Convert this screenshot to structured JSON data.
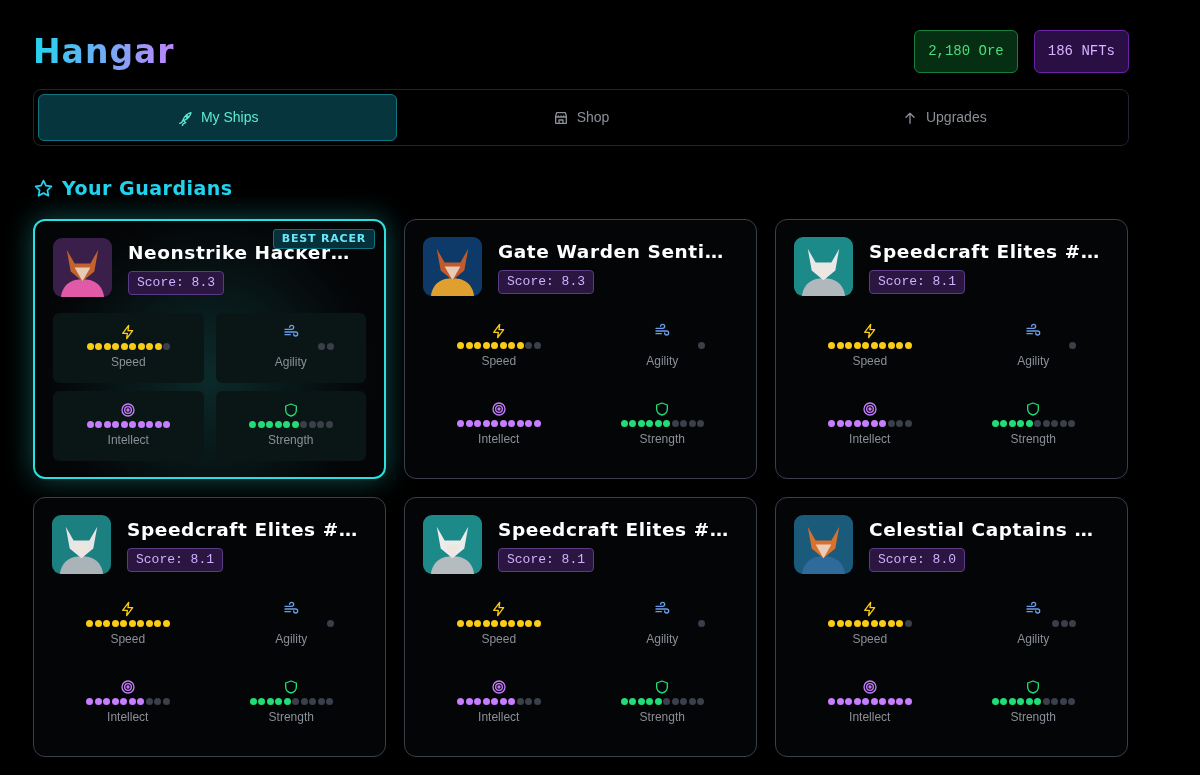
{
  "header": {
    "title": "Hangar",
    "balances": [
      {
        "kind": "ore",
        "text": "2,180 Ore"
      },
      {
        "kind": "nft",
        "text": "186 NFTs"
      }
    ]
  },
  "tabs": [
    {
      "kind": "rocket",
      "label": "My Ships",
      "selected": true
    },
    {
      "kind": "shop",
      "label": "Shop",
      "selected": false
    },
    {
      "kind": "upgrade",
      "label": "Upgrades",
      "selected": false
    }
  ],
  "section": {
    "title": "Your Guardians"
  },
  "cards": [
    {
      "name": "Neonstrike Hacker…",
      "score": "Score: 8.3",
      "badge": "BEST RACER",
      "highlighted": true,
      "stats": [
        {
          "kind": "speed",
          "label": "Speed",
          "dots": [
            true,
            true,
            true,
            true,
            true,
            true,
            true,
            true,
            true,
            false
          ]
        },
        {
          "kind": "agility",
          "label": "Agility",
          "dots": [
            false,
            false
          ]
        },
        {
          "kind": "intellect",
          "label": "Intellect",
          "dots": [
            true,
            true,
            true,
            true,
            true,
            true,
            true,
            true,
            true,
            true
          ]
        },
        {
          "kind": "strength",
          "label": "Strength",
          "dots": [
            true,
            true,
            true,
            true,
            true,
            true,
            false,
            false,
            false,
            false
          ]
        }
      ]
    },
    {
      "name": "Gate Warden Senti…",
      "score": "Score: 8.3",
      "highlighted": false,
      "stats": [
        {
          "kind": "speed",
          "label": "Speed",
          "dots": [
            true,
            true,
            true,
            true,
            true,
            true,
            true,
            true,
            false,
            false
          ]
        },
        {
          "kind": "agility",
          "label": "Agility",
          "dots": [
            false
          ]
        },
        {
          "kind": "intellect",
          "label": "Intellect",
          "dots": [
            true,
            true,
            true,
            true,
            true,
            true,
            true,
            true,
            true,
            true
          ]
        },
        {
          "kind": "strength",
          "label": "Strength",
          "dots": [
            true,
            true,
            true,
            true,
            true,
            true,
            false,
            false,
            false,
            false
          ]
        }
      ]
    },
    {
      "name": "Speedcraft Elites #…",
      "score": "Score: 8.1",
      "highlighted": false,
      "stats": [
        {
          "kind": "speed",
          "label": "Speed",
          "dots": [
            true,
            true,
            true,
            true,
            true,
            true,
            true,
            true,
            true,
            true
          ]
        },
        {
          "kind": "agility",
          "label": "Agility",
          "dots": [
            false
          ]
        },
        {
          "kind": "intellect",
          "label": "Intellect",
          "dots": [
            true,
            true,
            true,
            true,
            true,
            true,
            true,
            false,
            false,
            false
          ]
        },
        {
          "kind": "strength",
          "label": "Strength",
          "dots": [
            true,
            true,
            true,
            true,
            true,
            false,
            false,
            false,
            false,
            false
          ]
        }
      ]
    },
    {
      "name": "Speedcraft Elites #…",
      "score": "Score: 8.1",
      "highlighted": false,
      "stats": [
        {
          "kind": "speed",
          "label": "Speed",
          "dots": [
            true,
            true,
            true,
            true,
            true,
            true,
            true,
            true,
            true,
            true
          ]
        },
        {
          "kind": "agility",
          "label": "Agility",
          "dots": [
            false
          ]
        },
        {
          "kind": "intellect",
          "label": "Intellect",
          "dots": [
            true,
            true,
            true,
            true,
            true,
            true,
            true,
            false,
            false,
            false
          ]
        },
        {
          "kind": "strength",
          "label": "Strength",
          "dots": [
            true,
            true,
            true,
            true,
            true,
            false,
            false,
            false,
            false,
            false
          ]
        }
      ]
    },
    {
      "name": "Speedcraft Elites #…",
      "score": "Score: 8.1",
      "highlighted": false,
      "stats": [
        {
          "kind": "speed",
          "label": "Speed",
          "dots": [
            true,
            true,
            true,
            true,
            true,
            true,
            true,
            true,
            true,
            true
          ]
        },
        {
          "kind": "agility",
          "label": "Agility",
          "dots": [
            false
          ]
        },
        {
          "kind": "intellect",
          "label": "Intellect",
          "dots": [
            true,
            true,
            true,
            true,
            true,
            true,
            true,
            false,
            false,
            false
          ]
        },
        {
          "kind": "strength",
          "label": "Strength",
          "dots": [
            true,
            true,
            true,
            true,
            true,
            false,
            false,
            false,
            false,
            false
          ]
        }
      ]
    },
    {
      "name": "Celestial Captains …",
      "score": "Score: 8.0",
      "highlighted": false,
      "stats": [
        {
          "kind": "speed",
          "label": "Speed",
          "dots": [
            true,
            true,
            true,
            true,
            true,
            true,
            true,
            true,
            true,
            false
          ]
        },
        {
          "kind": "agility",
          "label": "Agility",
          "dots": [
            false,
            false,
            false
          ]
        },
        {
          "kind": "intellect",
          "label": "Intellect",
          "dots": [
            true,
            true,
            true,
            true,
            true,
            true,
            true,
            true,
            true,
            true
          ]
        },
        {
          "kind": "strength",
          "label": "Strength",
          "dots": [
            true,
            true,
            true,
            true,
            true,
            true,
            false,
            false,
            false,
            false
          ]
        }
      ]
    }
  ]
}
